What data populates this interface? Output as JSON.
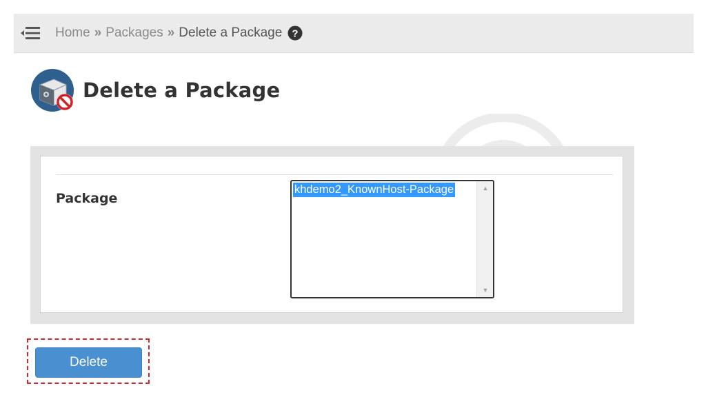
{
  "breadcrumb": {
    "home": "Home",
    "packages": "Packages",
    "current": "Delete a Package",
    "separator": "»"
  },
  "page": {
    "title": "Delete a Package"
  },
  "form": {
    "package_label": "Package",
    "package_options": [
      "khdemo2_KnownHost-Package"
    ],
    "selected_option": "khdemo2_KnownHost-Package"
  },
  "actions": {
    "delete_label": "Delete"
  },
  "colors": {
    "accent_button": "#4a90d0",
    "selected_option_bg": "#3399ff",
    "highlight_border": "#d7262b"
  },
  "icons": [
    "menu-collapse-icon",
    "help-icon",
    "delete-package-icon"
  ]
}
